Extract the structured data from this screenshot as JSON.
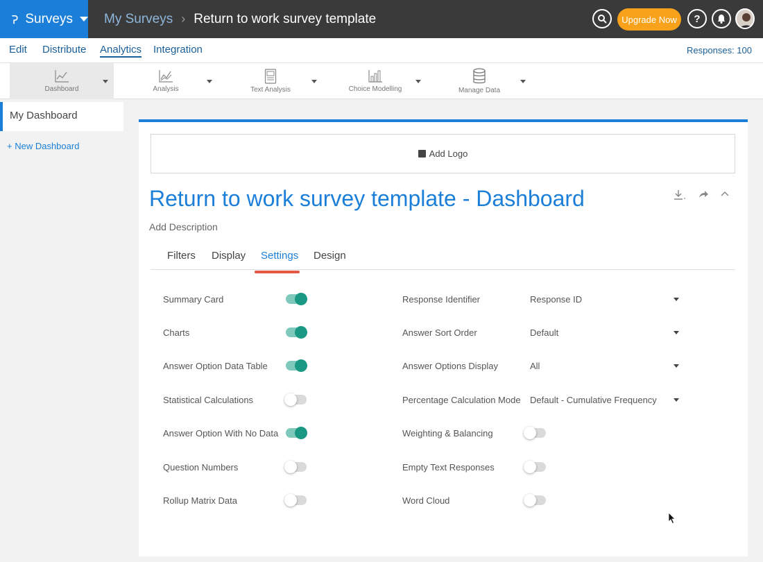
{
  "header": {
    "app_name": "Surveys",
    "breadcrumb_parent": "My Surveys",
    "breadcrumb_separator": "›",
    "survey_title": "Return to work survey template",
    "upgrade_label": "Upgrade Now",
    "help_label": "?"
  },
  "menu": {
    "items": [
      "Edit",
      "Distribute",
      "Analytics",
      "Integration"
    ],
    "active": "Analytics",
    "responses": "Responses: 100"
  },
  "toolbar": {
    "tools": [
      "Dashboard",
      "Analysis",
      "Text Analysis",
      "Choice Modelling",
      "Manage Data"
    ],
    "selected": "Dashboard"
  },
  "sidebar": {
    "item": "My Dashboard",
    "new_dashboard": "+ New Dashboard"
  },
  "dashboard": {
    "add_logo": "Add Logo",
    "title": "Return to work survey template - Dashboard",
    "add_description": "Add Description"
  },
  "tabs": {
    "items": [
      "Filters",
      "Display",
      "Settings",
      "Design"
    ],
    "active": "Settings"
  },
  "settings": {
    "toggles_left": [
      {
        "label": "Summary Card",
        "on": true
      },
      {
        "label": "Charts",
        "on": true
      },
      {
        "label": "Answer Option Data Table",
        "on": true
      },
      {
        "label": "Statistical Calculations",
        "on": false
      },
      {
        "label": "Answer Option With No Data",
        "on": true
      },
      {
        "label": "Question Numbers",
        "on": false
      },
      {
        "label": "Rollup Matrix Data",
        "on": false
      }
    ],
    "selects_right": [
      {
        "label": "Response Identifier",
        "value": "Response ID"
      },
      {
        "label": "Answer Sort Order",
        "value": "Default"
      },
      {
        "label": "Answer Options Display",
        "value": "All"
      },
      {
        "label": "Percentage Calculation Mode",
        "value": "Default - Cumulative Frequency"
      }
    ],
    "toggles_right": [
      {
        "label": "Weighting & Balancing",
        "on": false
      },
      {
        "label": "Empty Text Responses",
        "on": false
      },
      {
        "label": "Word Cloud",
        "on": false
      }
    ]
  },
  "colors": {
    "brand_blue": "#1b7fd9",
    "upgrade_orange": "#f7a21a",
    "toggle_on": "#1a9883",
    "tab_underline": "#e25a45"
  }
}
